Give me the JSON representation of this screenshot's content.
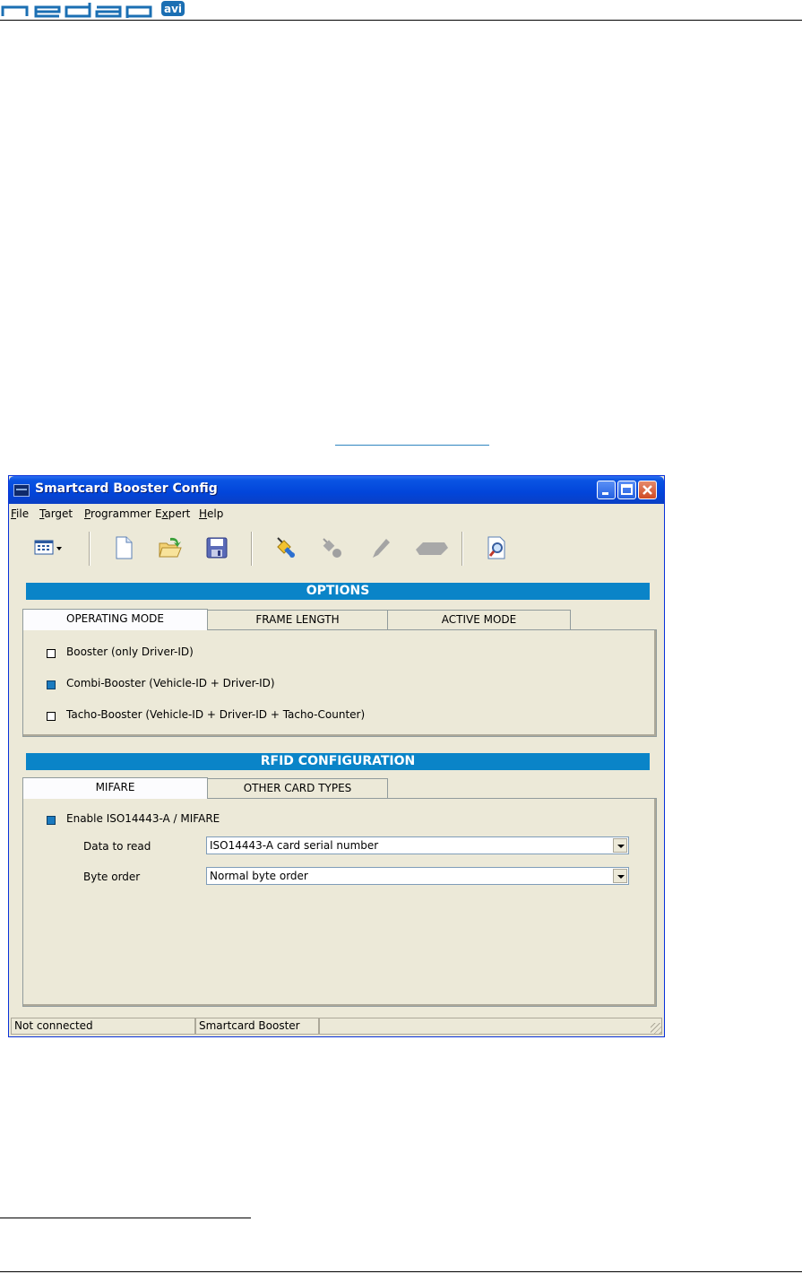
{
  "page": {
    "logo": {
      "brand": "nedap",
      "badge": "avi"
    }
  },
  "window": {
    "title": "Smartcard Booster Config",
    "controls": [
      "minimize",
      "maximize",
      "close"
    ]
  },
  "menu": [
    {
      "label": "File",
      "mnemonic": "F",
      "rest": "ile"
    },
    {
      "label": "Target",
      "mnemonic": "T",
      "rest": "arget"
    },
    {
      "label": "Programmer",
      "mnemonic": "P",
      "rest": "rogrammer"
    },
    {
      "label": "Expert",
      "mnemonic": "x",
      "pre": "E",
      "rest": "pert"
    },
    {
      "label": "Help",
      "mnemonic": "H",
      "rest": "elp"
    }
  ],
  "toolbar": {
    "icons": [
      "view-menu-icon",
      "new-file-icon",
      "open-folder-icon",
      "save-disk-icon",
      "connect-plug-icon",
      "disconnect-plug-icon",
      "pencil-icon",
      "eraser-icon",
      "preview-magnifier-icon"
    ],
    "enabled": [
      true,
      true,
      true,
      true,
      true,
      false,
      false,
      false,
      true
    ]
  },
  "options": {
    "header": "OPTIONS",
    "tabs": [
      "OPERATING MODE",
      "FRAME LENGTH",
      "ACTIVE MODE"
    ],
    "active_tab": "OPERATING MODE",
    "modes": [
      {
        "label": "Booster   (only Driver-ID)",
        "checked": false
      },
      {
        "label": "Combi-Booster   (Vehicle-ID + Driver-ID)",
        "checked": true
      },
      {
        "label": "Tacho-Booster   (Vehicle-ID + Driver-ID + Tacho-Counter)",
        "checked": false
      }
    ]
  },
  "rfid": {
    "header": "RFID CONFIGURATION",
    "tabs": [
      "MIFARE",
      "OTHER CARD TYPES"
    ],
    "active_tab": "MIFARE",
    "enable_label": "Enable ISO14443-A / MIFARE",
    "enable_checked": true,
    "data_to_read": {
      "label": "Data to read",
      "value": "ISO14443-A card serial number"
    },
    "byte_order": {
      "label": "Byte order",
      "value": "Normal byte order"
    }
  },
  "status": {
    "connection": "Not connected",
    "device": "Smartcard Booster",
    "extra": ""
  },
  "colors": {
    "accent_blue": "#0a84c8",
    "title_blue": "#0245da",
    "window_bg": "#ece9d8",
    "link": "#2f86c0"
  }
}
